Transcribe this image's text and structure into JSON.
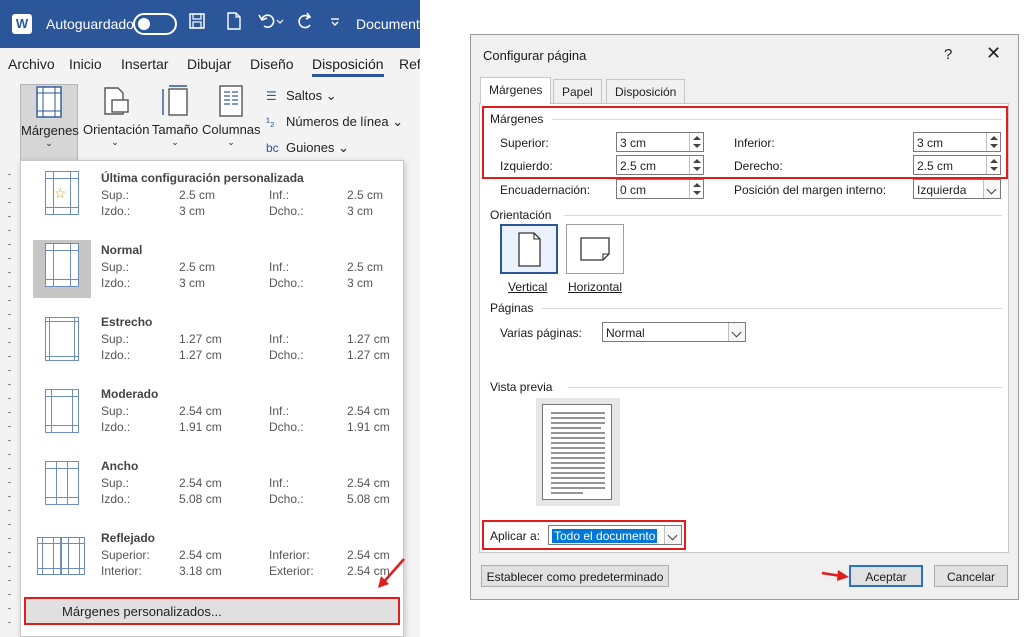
{
  "word": {
    "autosave_label": "Autoguardado",
    "doc_name": "Documento",
    "tabs": [
      "Archivo",
      "Inicio",
      "Insertar",
      "Dibujar",
      "Diseño",
      "Disposición",
      "Ref"
    ],
    "active_tab": "Disposición",
    "ribbon": {
      "margins": "Márgenes",
      "orientation": "Orientación",
      "size": "Tamaño",
      "columns": "Columnas",
      "breaks": "Saltos",
      "line_numbers": "Números de línea",
      "hyphenation": "Guiones"
    },
    "margins_menu": {
      "presets": [
        {
          "title": "Última configuración personalizada",
          "l1": "Sup.:",
          "v1": "2.5 cm",
          "l2": "Inf.:",
          "v2": "2.5 cm",
          "l3": "Izdo.:",
          "v3": "3 cm",
          "l4": "Dcho.:",
          "v4": "3 cm"
        },
        {
          "title": "Normal",
          "l1": "Sup.:",
          "v1": "2.5 cm",
          "l2": "Inf.:",
          "v2": "2.5 cm",
          "l3": "Izdo.:",
          "v3": "3 cm",
          "l4": "Dcho.:",
          "v4": "3 cm"
        },
        {
          "title": "Estrecho",
          "l1": "Sup.:",
          "v1": "1.27 cm",
          "l2": "Inf.:",
          "v2": "1.27 cm",
          "l3": "Izdo.:",
          "v3": "1.27 cm",
          "l4": "Dcho.:",
          "v4": "1.27 cm"
        },
        {
          "title": "Moderado",
          "l1": "Sup.:",
          "v1": "2.54 cm",
          "l2": "Inf.:",
          "v2": "2.54 cm",
          "l3": "Izdo.:",
          "v3": "1.91 cm",
          "l4": "Dcho.:",
          "v4": "1.91 cm"
        },
        {
          "title": "Ancho",
          "l1": "Sup.:",
          "v1": "2.54 cm",
          "l2": "Inf.:",
          "v2": "2.54 cm",
          "l3": "Izdo.:",
          "v3": "5.08 cm",
          "l4": "Dcho.:",
          "v4": "5.08 cm"
        },
        {
          "title": "Reflejado",
          "l1": "Superior:",
          "v1": "2.54 cm",
          "l2": "Inferior:",
          "v2": "2.54 cm",
          "l3": "Interior:",
          "v3": "3.18 cm",
          "l4": "Exterior:",
          "v4": "2.54 cm"
        }
      ],
      "custom_label": "Márgenes personalizados..."
    }
  },
  "dialog": {
    "title": "Configurar página",
    "help": "?",
    "close": "✕",
    "tabs": [
      "Márgenes",
      "Papel",
      "Disposición"
    ],
    "margins_group": "Márgenes",
    "top_label": "Superior:",
    "top_value": "3 cm",
    "bottom_label": "Inferior:",
    "bottom_value": "3 cm",
    "left_label": "Izquierdo:",
    "left_value": "2.5 cm",
    "right_label": "Derecho:",
    "right_value": "2.5 cm",
    "gutter_label": "Encuadernación:",
    "gutter_value": "0 cm",
    "gutter_pos_label": "Posición del margen interno:",
    "gutter_pos_value": "Izquierda",
    "orientation_group": "Orientación",
    "portrait": "Vertical",
    "landscape": "Horizontal",
    "pages_group": "Páginas",
    "multiple_pages_label": "Varias páginas:",
    "multiple_pages_value": "Normal",
    "preview_group": "Vista previa",
    "apply_label": "Aplicar a:",
    "apply_value": "Todo el documento",
    "set_default": "Establecer como predeterminado",
    "ok": "Aceptar",
    "cancel": "Cancelar"
  },
  "colors": {
    "word_blue": "#2b579a",
    "annotation_red": "#e01c1c",
    "selection_blue": "#0078d7"
  }
}
